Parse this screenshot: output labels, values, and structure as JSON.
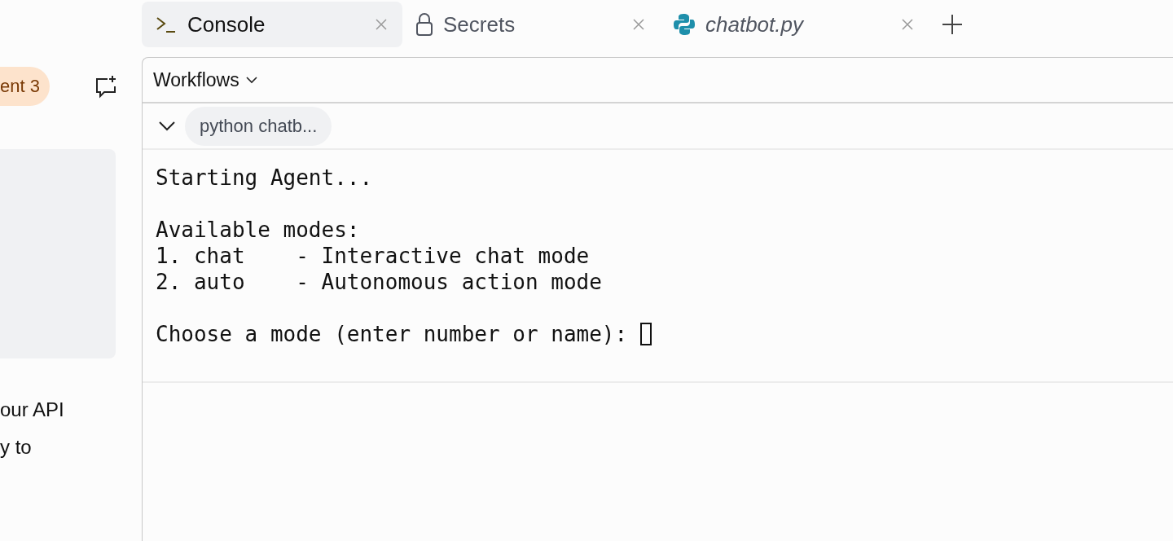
{
  "sidebar": {
    "badge": "ent 3",
    "text_lines": [
      "our API",
      "y to"
    ]
  },
  "tabs": [
    {
      "label": "Console",
      "kind": "console",
      "selected": true,
      "preview": false
    },
    {
      "label": "Secrets",
      "kind": "secrets",
      "selected": false,
      "preview": false
    },
    {
      "label": "chatbot.py",
      "kind": "python",
      "selected": false,
      "preview": true
    }
  ],
  "toolbar": {
    "label": "Workflows"
  },
  "run": {
    "label": "python chatb...",
    "expanded": true
  },
  "console": {
    "blocks": [
      [
        "Starting Agent..."
      ],
      [
        "Available modes:",
        "1. chat    - Interactive chat mode",
        "2. auto    - Autonomous action mode"
      ],
      [
        "Choose a mode (enter number or name): "
      ]
    ],
    "cursor": true
  }
}
